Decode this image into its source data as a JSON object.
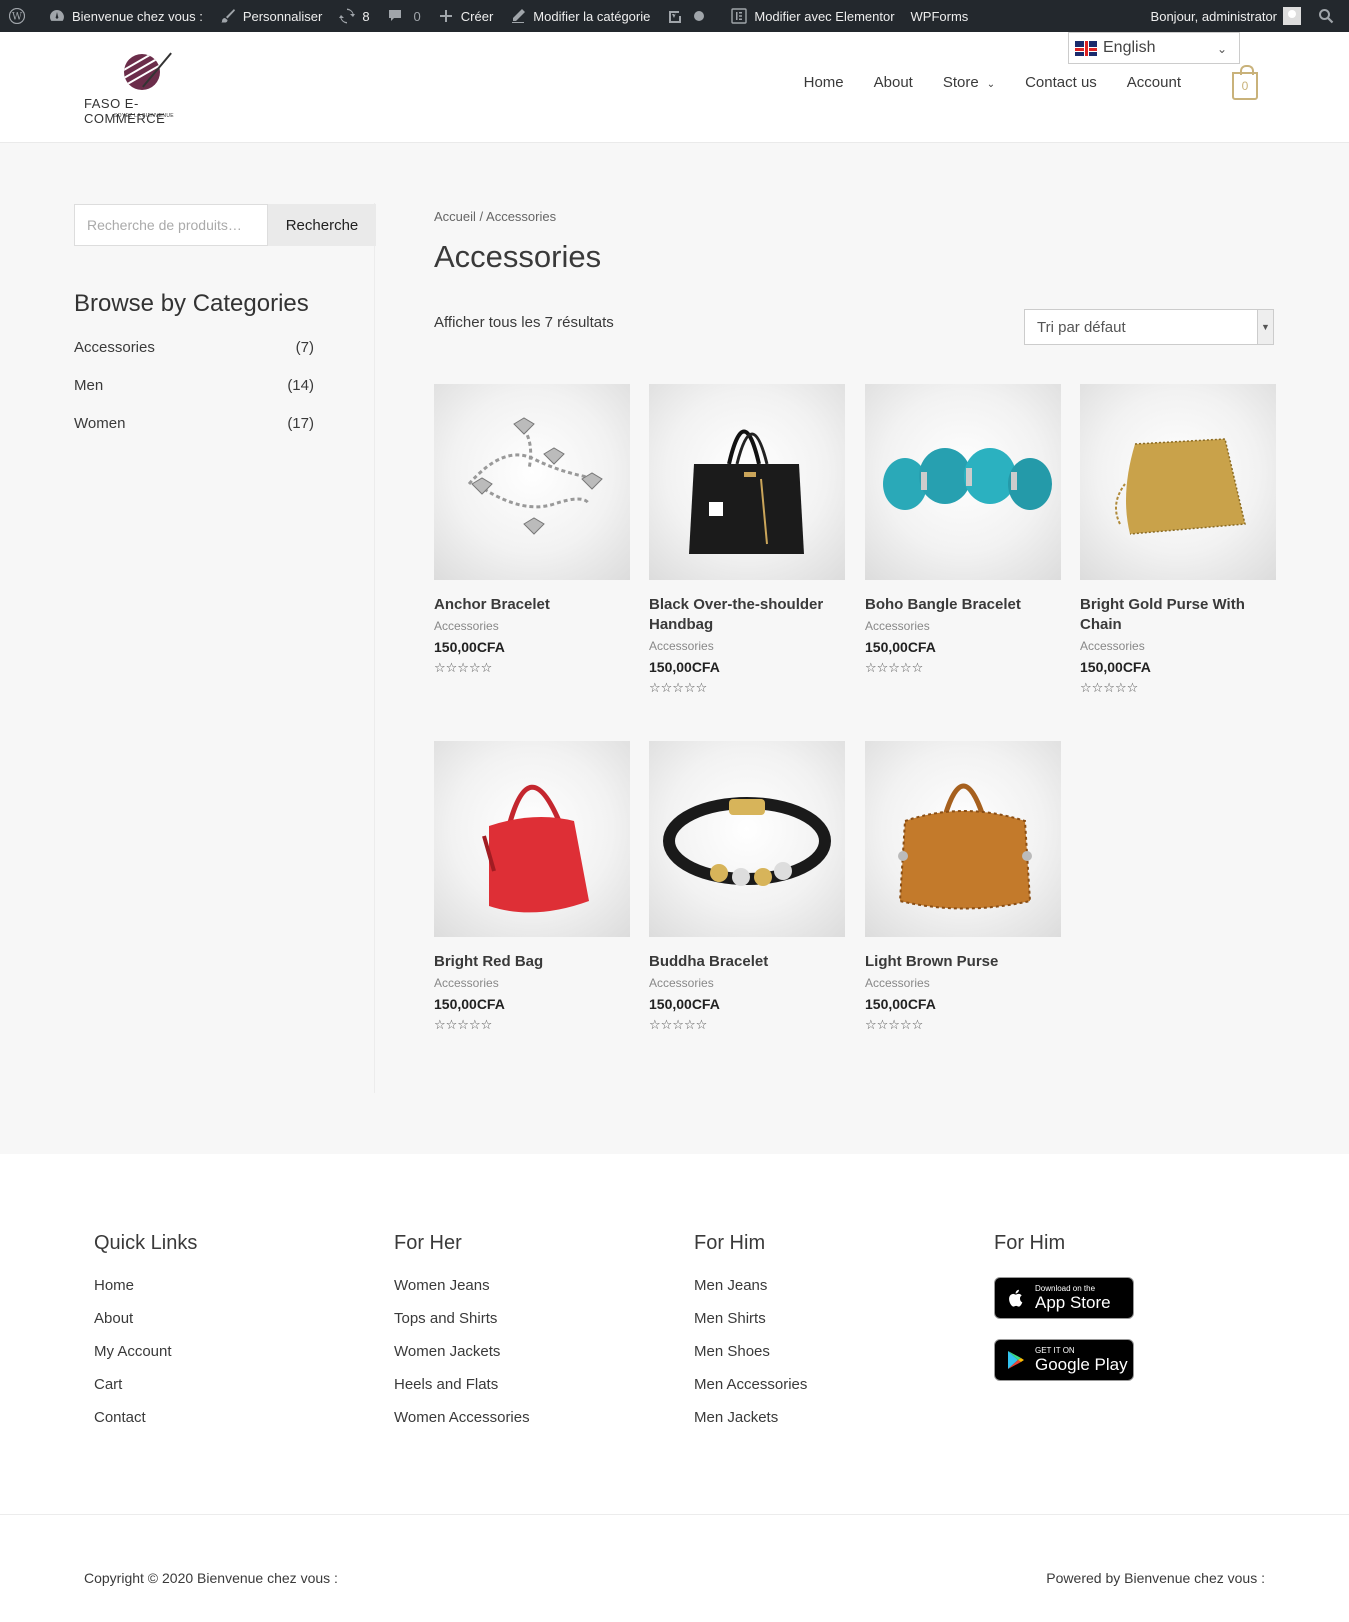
{
  "adminbar": {
    "site_name": "Bienvenue chez vous :",
    "customize": "Personnaliser",
    "updates_count": "8",
    "comments_count": "0",
    "create": "Créer",
    "edit_category": "Modifier la catégorie",
    "edit_elementor": "Modifier avec Elementor",
    "wpforms": "WPForms",
    "greeting": "Bonjour, administrator"
  },
  "header": {
    "brand": "FASO E-COMMERCE",
    "tagline": "SOYEZ LA BIENVENUE",
    "language": "English",
    "nav": [
      "Home",
      "About",
      "Store",
      "Contact us",
      "Account"
    ],
    "cart_count": "0"
  },
  "sidebar": {
    "search_placeholder": "Recherche de produits…",
    "search_button": "Recherche",
    "categories_title": "Browse by Categories",
    "categories": [
      {
        "name": "Accessories",
        "count": "(7)"
      },
      {
        "name": "Men",
        "count": "(14)"
      },
      {
        "name": "Women",
        "count": "(17)"
      }
    ]
  },
  "shop": {
    "breadcrumb": "Accueil / Accessories",
    "title": "Accessories",
    "results": "Afficher tous les 7 résultats",
    "sort": "Tri par défaut",
    "products": [
      {
        "name": "Anchor Bracelet",
        "category": "Accessories",
        "price": "150,00CFA",
        "rating": "☆☆☆☆☆"
      },
      {
        "name": "Black Over-the-shoulder Handbag",
        "category": "Accessories",
        "price": "150,00CFA",
        "rating": "☆☆☆☆☆"
      },
      {
        "name": "Boho Bangle Bracelet",
        "category": "Accessories",
        "price": "150,00CFA",
        "rating": "☆☆☆☆☆"
      },
      {
        "name": "Bright Gold Purse With Chain",
        "category": "Accessories",
        "price": "150,00CFA",
        "rating": "☆☆☆☆☆"
      },
      {
        "name": "Bright Red Bag",
        "category": "Accessories",
        "price": "150,00CFA",
        "rating": "☆☆☆☆☆"
      },
      {
        "name": "Buddha Bracelet",
        "category": "Accessories",
        "price": "150,00CFA",
        "rating": "☆☆☆☆☆"
      },
      {
        "name": "Light Brown Purse",
        "category": "Accessories",
        "price": "150,00CFA",
        "rating": "☆☆☆☆☆"
      }
    ]
  },
  "footer": {
    "quick_links": {
      "title": "Quick Links",
      "items": [
        "Home",
        "About",
        "My Account",
        "Cart",
        "Contact"
      ]
    },
    "for_her": {
      "title": "For Her",
      "items": [
        "Women Jeans",
        "Tops and Shirts",
        "Women Jackets",
        "Heels and Flats",
        "Women Accessories"
      ]
    },
    "for_him": {
      "title": "For Him",
      "items": [
        "Men Jeans",
        "Men Shirts",
        "Men Shoes",
        "Men Accessories",
        "Men Jackets"
      ]
    },
    "apps": {
      "title": "For Him",
      "appstore_small": "Download on the",
      "appstore_big": "App Store",
      "googleplay_small": "GET IT ON",
      "googleplay_big": "Google Play"
    },
    "copyright": "Copyright © 2020 Bienvenue chez vous :",
    "powered": "Powered by Bienvenue chez vous :"
  },
  "colors": {
    "adminbar": "#23282d",
    "page_bg": "#f7f7f7",
    "cart_accent": "#c9b27a"
  }
}
